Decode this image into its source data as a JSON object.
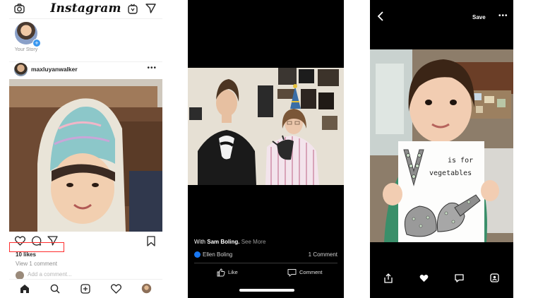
{
  "instagram": {
    "brand": "Instagram",
    "story": {
      "label": "Your Story"
    },
    "post": {
      "username": "maxluyanwalker",
      "likes": "10 likes",
      "view_comment": "View 1 comment",
      "add_comment": "Add a comment..."
    },
    "icons": [
      "camera-icon",
      "igtv-icon",
      "direct-icon",
      "heart-icon",
      "comment-icon",
      "share-icon",
      "bookmark-icon",
      "home-icon",
      "search-icon",
      "add-icon",
      "activity-icon",
      "profile-icon"
    ]
  },
  "facebook": {
    "caption_prefix": "With",
    "caption_name": "Sam Boling.",
    "caption_more": "See More",
    "author": "Ellen Boling",
    "comments": "1 Comment",
    "like_label": "Like",
    "comment_label": "Comment"
  },
  "viewer": {
    "save_label": "Save",
    "more_label": "•••",
    "sign": {
      "letter": "V",
      "text": "is for vegetables"
    }
  },
  "colors": {
    "highlight": "#ff2d2d",
    "ig_plus": "#3897f0",
    "fb_blue": "#1877f2"
  }
}
